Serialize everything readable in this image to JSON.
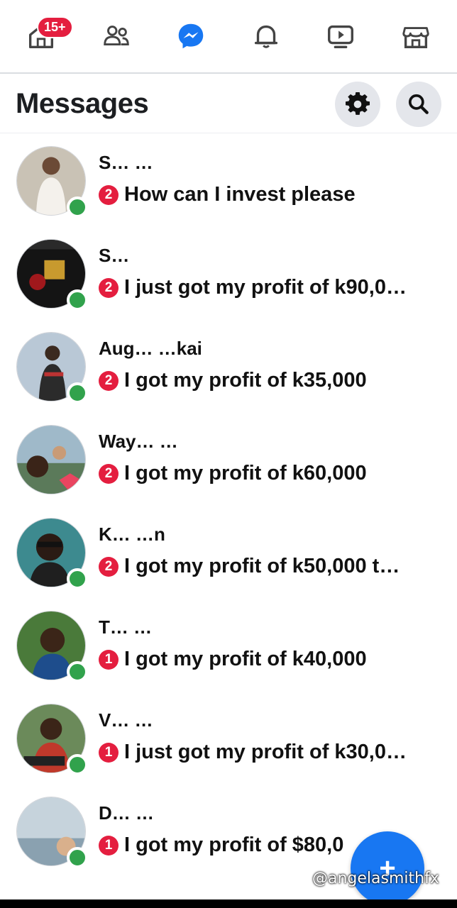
{
  "nav": {
    "home_badge": "15+",
    "items": [
      "home-icon",
      "friends-icon",
      "messenger-icon",
      "bell-icon",
      "video-icon",
      "marketplace-icon"
    ]
  },
  "header": {
    "title": "Messages"
  },
  "conversations": [
    {
      "name": "S… …",
      "count": "2",
      "message": "How can I invest please",
      "online": true
    },
    {
      "name": "S…",
      "count": "2",
      "message": "I just got my profit of k90,0…",
      "online": true
    },
    {
      "name": "Aug… …kai",
      "count": "2",
      "message": "I got my profit of k35,000",
      "online": true
    },
    {
      "name": "Way… …",
      "count": "2",
      "message": "I got my profit of k60,000",
      "online": false
    },
    {
      "name": "K… …n",
      "count": "2",
      "message": "I got my profit of k50,000 t…",
      "online": true
    },
    {
      "name": "T… …",
      "count": "1",
      "message": "I got my profit of k40,000",
      "online": true
    },
    {
      "name": "V… …",
      "count": "1",
      "message": "I just got my profit of k30,0…",
      "online": true
    },
    {
      "name": "D… …",
      "count": "1",
      "message": "I got  my profit of $80,0",
      "online": true
    }
  ],
  "fab_label": "+",
  "watermark": "@angelasmithfx",
  "colors": {
    "accent": "#1877f2",
    "badge": "#e41e3f",
    "online": "#31a24c"
  }
}
